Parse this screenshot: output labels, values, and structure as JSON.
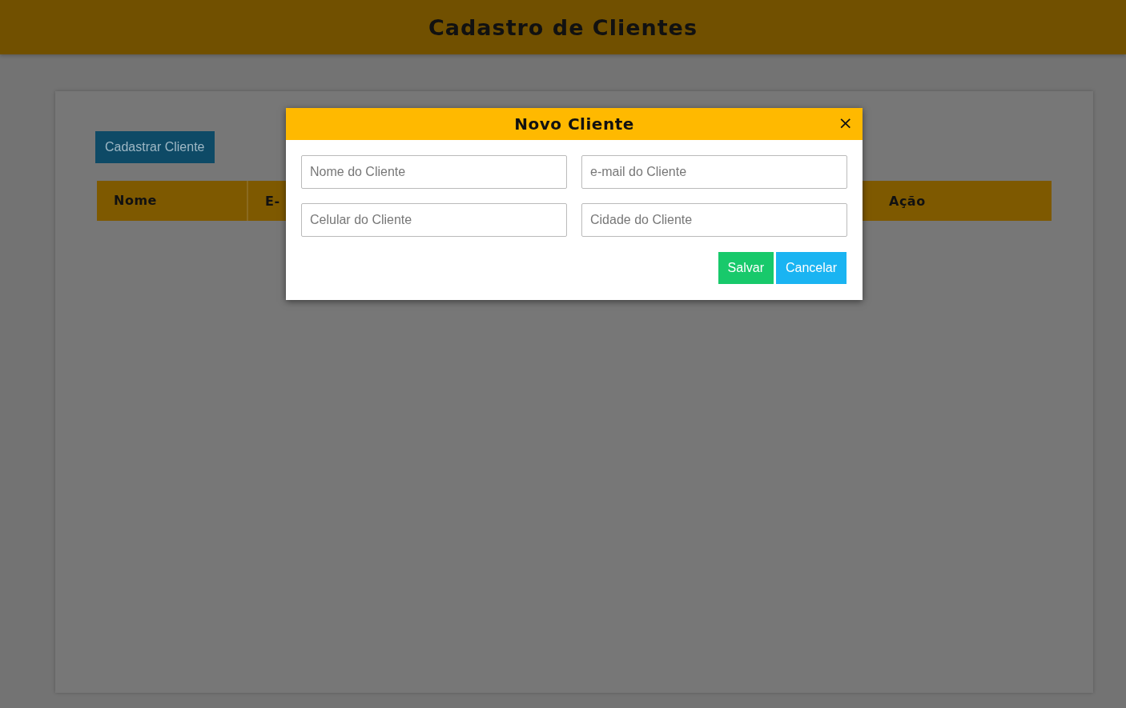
{
  "header": {
    "title": "Cadastro de Clientes"
  },
  "register_button": {
    "label": "Cadastrar Cliente"
  },
  "table": {
    "columns": [
      {
        "label": "Nome"
      },
      {
        "label": "E-"
      },
      {
        "label": "Ação"
      }
    ]
  },
  "modal": {
    "title": "Novo Cliente",
    "close": "×",
    "fields": [
      {
        "placeholder": "Nome do Cliente"
      },
      {
        "placeholder": "e-mail do Cliente"
      },
      {
        "placeholder": "Celular do Cliente"
      },
      {
        "placeholder": "Cidade do Cliente"
      }
    ],
    "buttons": [
      {
        "label": "Salvar",
        "kind": "save"
      },
      {
        "label": "Cancelar",
        "kind": "cancel"
      }
    ]
  }
}
